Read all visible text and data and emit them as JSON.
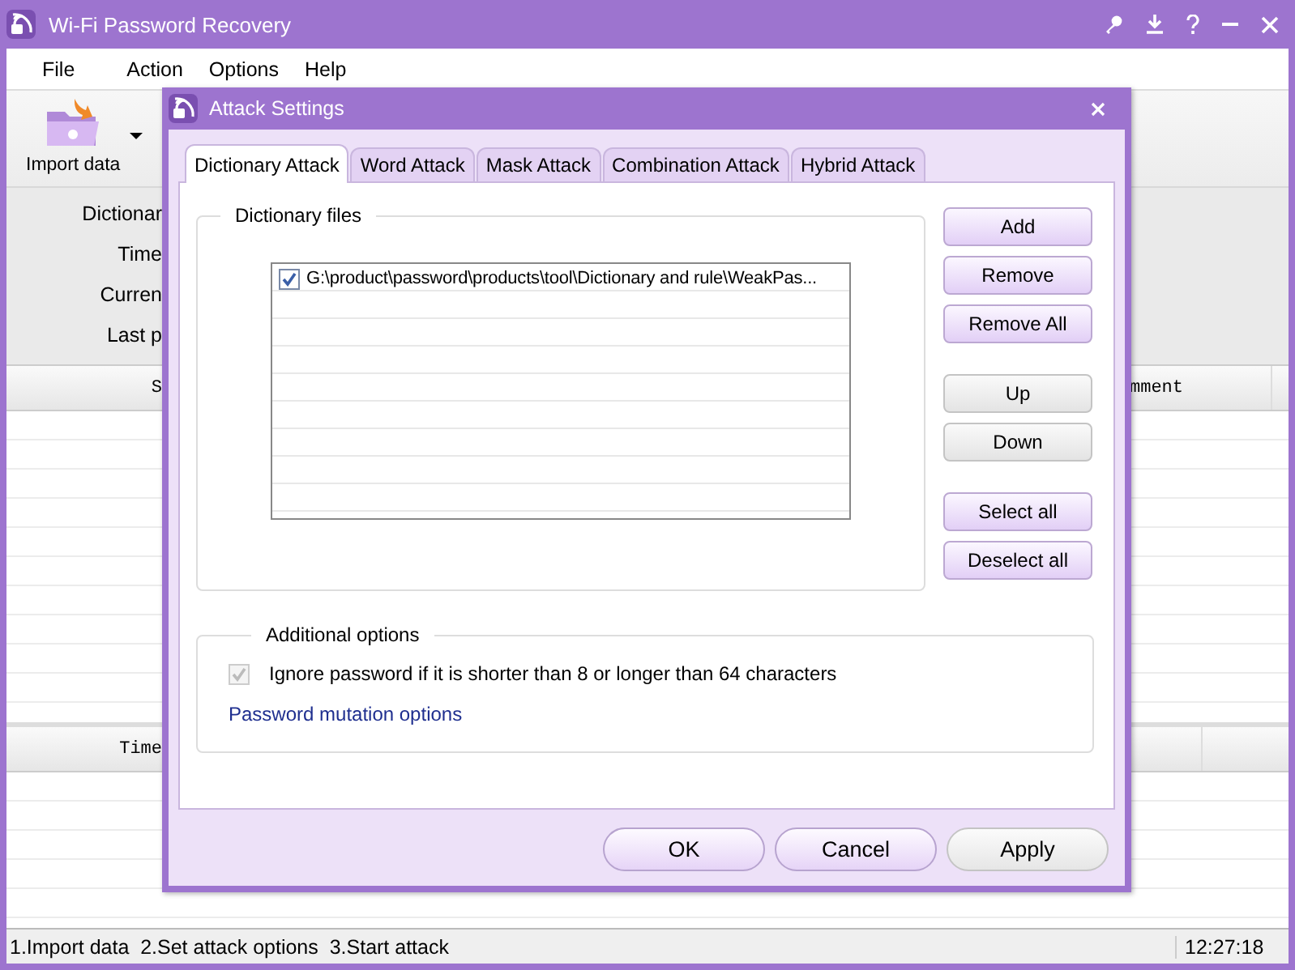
{
  "window": {
    "title": "Wi-Fi Password Recovery"
  },
  "menu": [
    "File",
    "Action",
    "Options",
    "Help"
  ],
  "toolbar": {
    "import_label": "Import data"
  },
  "info_labels": [
    "Dictionar",
    "Time",
    "Curren",
    "Last p"
  ],
  "results_table": {
    "columns": [
      "S",
      "mment"
    ]
  },
  "log_table": {
    "columns": [
      "Time"
    ]
  },
  "status_bar": {
    "steps": "1.Import data  2.Set attack options  3.Start attack",
    "time": "12:27:18"
  },
  "dialog": {
    "title": "Attack Settings",
    "tabs": [
      {
        "label": "Dictionary Attack",
        "selected": true
      },
      {
        "label": "Word Attack",
        "selected": false
      },
      {
        "label": "Mask Attack",
        "selected": false
      },
      {
        "label": "Combination Attack",
        "selected": false
      },
      {
        "label": "Hybrid Attack",
        "selected": false
      }
    ],
    "dictionary_files": {
      "legend": "Dictionary files",
      "files": [
        {
          "path": "G:\\product\\password\\products\\tool\\Dictionary and rule\\WeakPas...",
          "checked": true
        }
      ]
    },
    "side_button_groups": [
      [
        {
          "label": "Add",
          "disabled": false
        },
        {
          "label": "Remove",
          "disabled": false
        },
        {
          "label": "Remove All",
          "disabled": false
        }
      ],
      [
        {
          "label": "Up",
          "disabled": true
        },
        {
          "label": "Down",
          "disabled": true
        }
      ],
      [
        {
          "label": "Select all",
          "disabled": false
        },
        {
          "label": "Deselect all",
          "disabled": false
        }
      ]
    ],
    "additional_options": {
      "legend": "Additional options",
      "ignore_option": {
        "label": "Ignore password if it is shorter than 8 or longer than 64 characters",
        "checked": true,
        "disabled": true
      },
      "link": "Password mutation options"
    },
    "buttons": [
      {
        "label": "OK",
        "disabled": false
      },
      {
        "label": "Cancel",
        "disabled": false
      },
      {
        "label": "Apply",
        "disabled": true
      }
    ]
  }
}
